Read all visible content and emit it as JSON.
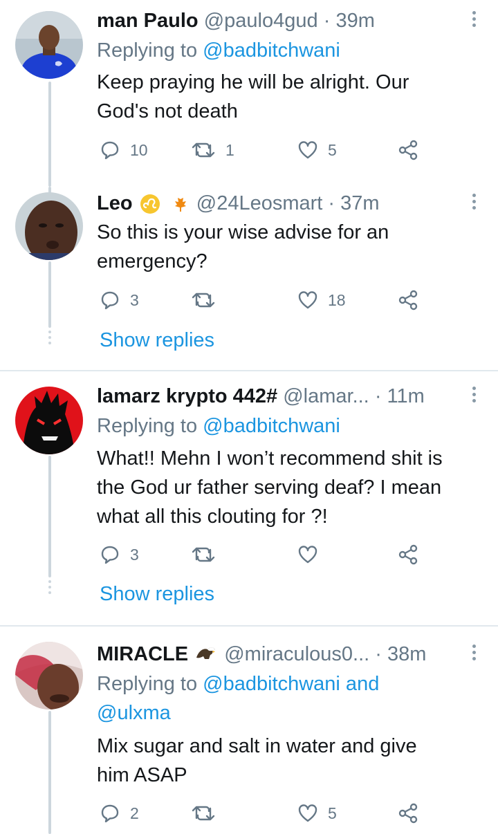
{
  "tweets": [
    {
      "name": "man Paulo",
      "handle": "@paulo4gud",
      "separator": "·",
      "time": "39m",
      "reply_prefix": "Replying to",
      "reply_mention": "@badbitchwani",
      "reply_more": "",
      "text_lines": [
        "Keep praying he will be alright. Our",
        "God's not death"
      ],
      "replies": "10",
      "retweets": "1",
      "likes": "5",
      "avatar_icon": "avatar-man-blue-shirt"
    },
    {
      "name": "Leo",
      "handle": "@24Leosmart",
      "separator": "·",
      "time": "37m",
      "badges": [
        "leo-zodiac-icon",
        "maple-leaf-icon"
      ],
      "text_lines": [
        "So this is your wise advise for an",
        "emergency?"
      ],
      "replies": "3",
      "retweets": "",
      "likes": "18",
      "show_replies": "Show replies",
      "avatar_icon": "avatar-man-closeup"
    },
    {
      "name": "lamarz krypto 442#",
      "handle": "@lamar...",
      "separator": "·",
      "time": "11m",
      "reply_prefix": "Replying to",
      "reply_mention": "@badbitchwani",
      "text_lines": [
        "What!! Mehn I won’t recommend shit is",
        "the God ur father serving deaf? I mean",
        "what all this clouting for ?!"
      ],
      "replies": "3",
      "retweets": "",
      "likes": "",
      "show_replies": "Show replies",
      "avatar_icon": "avatar-dark-anime"
    },
    {
      "name": "MIRACLE",
      "handle": "@miraculous0...",
      "separator": "·",
      "time": "38m",
      "badges": [
        "eagle-icon"
      ],
      "reply_prefix": "Replying to",
      "reply_mention": "@badbitchwani and",
      "reply_mention2": "@ulxma",
      "text_lines": [
        "Mix sugar and salt in water and give",
        "him ASAP"
      ],
      "replies": "2",
      "retweets": "",
      "likes": "5",
      "avatar_icon": "avatar-person-selfie"
    }
  ],
  "colors": {
    "link": "#1b95e0",
    "muted": "#657786",
    "line": "#ccd6dd",
    "divider": "#e1e8ed"
  }
}
